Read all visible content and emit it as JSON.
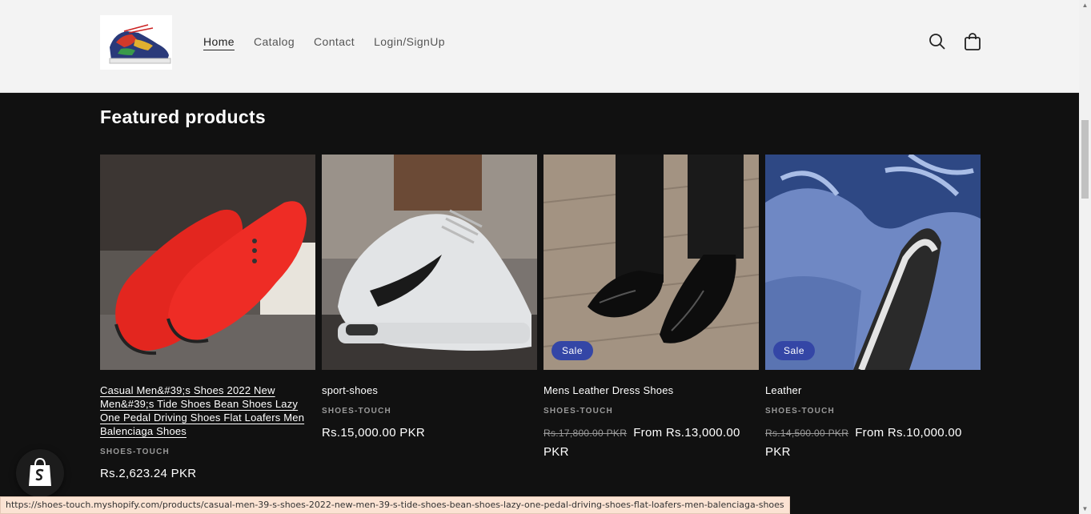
{
  "header": {
    "logo_alt": "shoe-logo",
    "nav": [
      {
        "label": "Home",
        "active": true
      },
      {
        "label": "Catalog",
        "active": false
      },
      {
        "label": "Contact",
        "active": false
      },
      {
        "label": "Login/SignUp",
        "active": false
      }
    ],
    "icons": [
      "search-icon",
      "cart-icon"
    ]
  },
  "featured": {
    "heading": "Featured products",
    "products": [
      {
        "title": "Casual Men&#39;s Shoes 2022 New Men&#39;s Tide Shoes Bean Shoes Lazy One Pedal Driving Shoes Flat Loafers Men Balenciaga Shoes",
        "vendor": "SHOES-TOUCH",
        "price": "Rs.2,623.24 PKR",
        "old_price": "",
        "badge": ""
      },
      {
        "title": "sport-shoes",
        "vendor": "SHOES-TOUCH",
        "price": "Rs.15,000.00 PKR",
        "old_price": "",
        "badge": ""
      },
      {
        "title": "Mens Leather Dress Shoes",
        "vendor": "SHOES-TOUCH",
        "price": "From Rs.13,000.00 PKR",
        "old_price": "Rs.17,800.00 PKR",
        "badge": "Sale"
      },
      {
        "title": "Leather",
        "vendor": "SHOES-TOUCH",
        "price": "From Rs.10,000.00 PKR",
        "old_price": "Rs.14,500.00 PKR",
        "badge": "Sale"
      }
    ]
  },
  "status_bar": {
    "url": "https://shoes-touch.myshopify.com/products/casual-men-39-s-shoes-2022-new-men-39-s-tide-shoes-bean-shoes-lazy-one-pedal-driving-shoes-flat-loafers-men-balenciaga-shoes"
  },
  "colors": {
    "header_bg": "#f3f3f3",
    "page_bg": "#111111",
    "badge_bg": "#3446a6"
  }
}
